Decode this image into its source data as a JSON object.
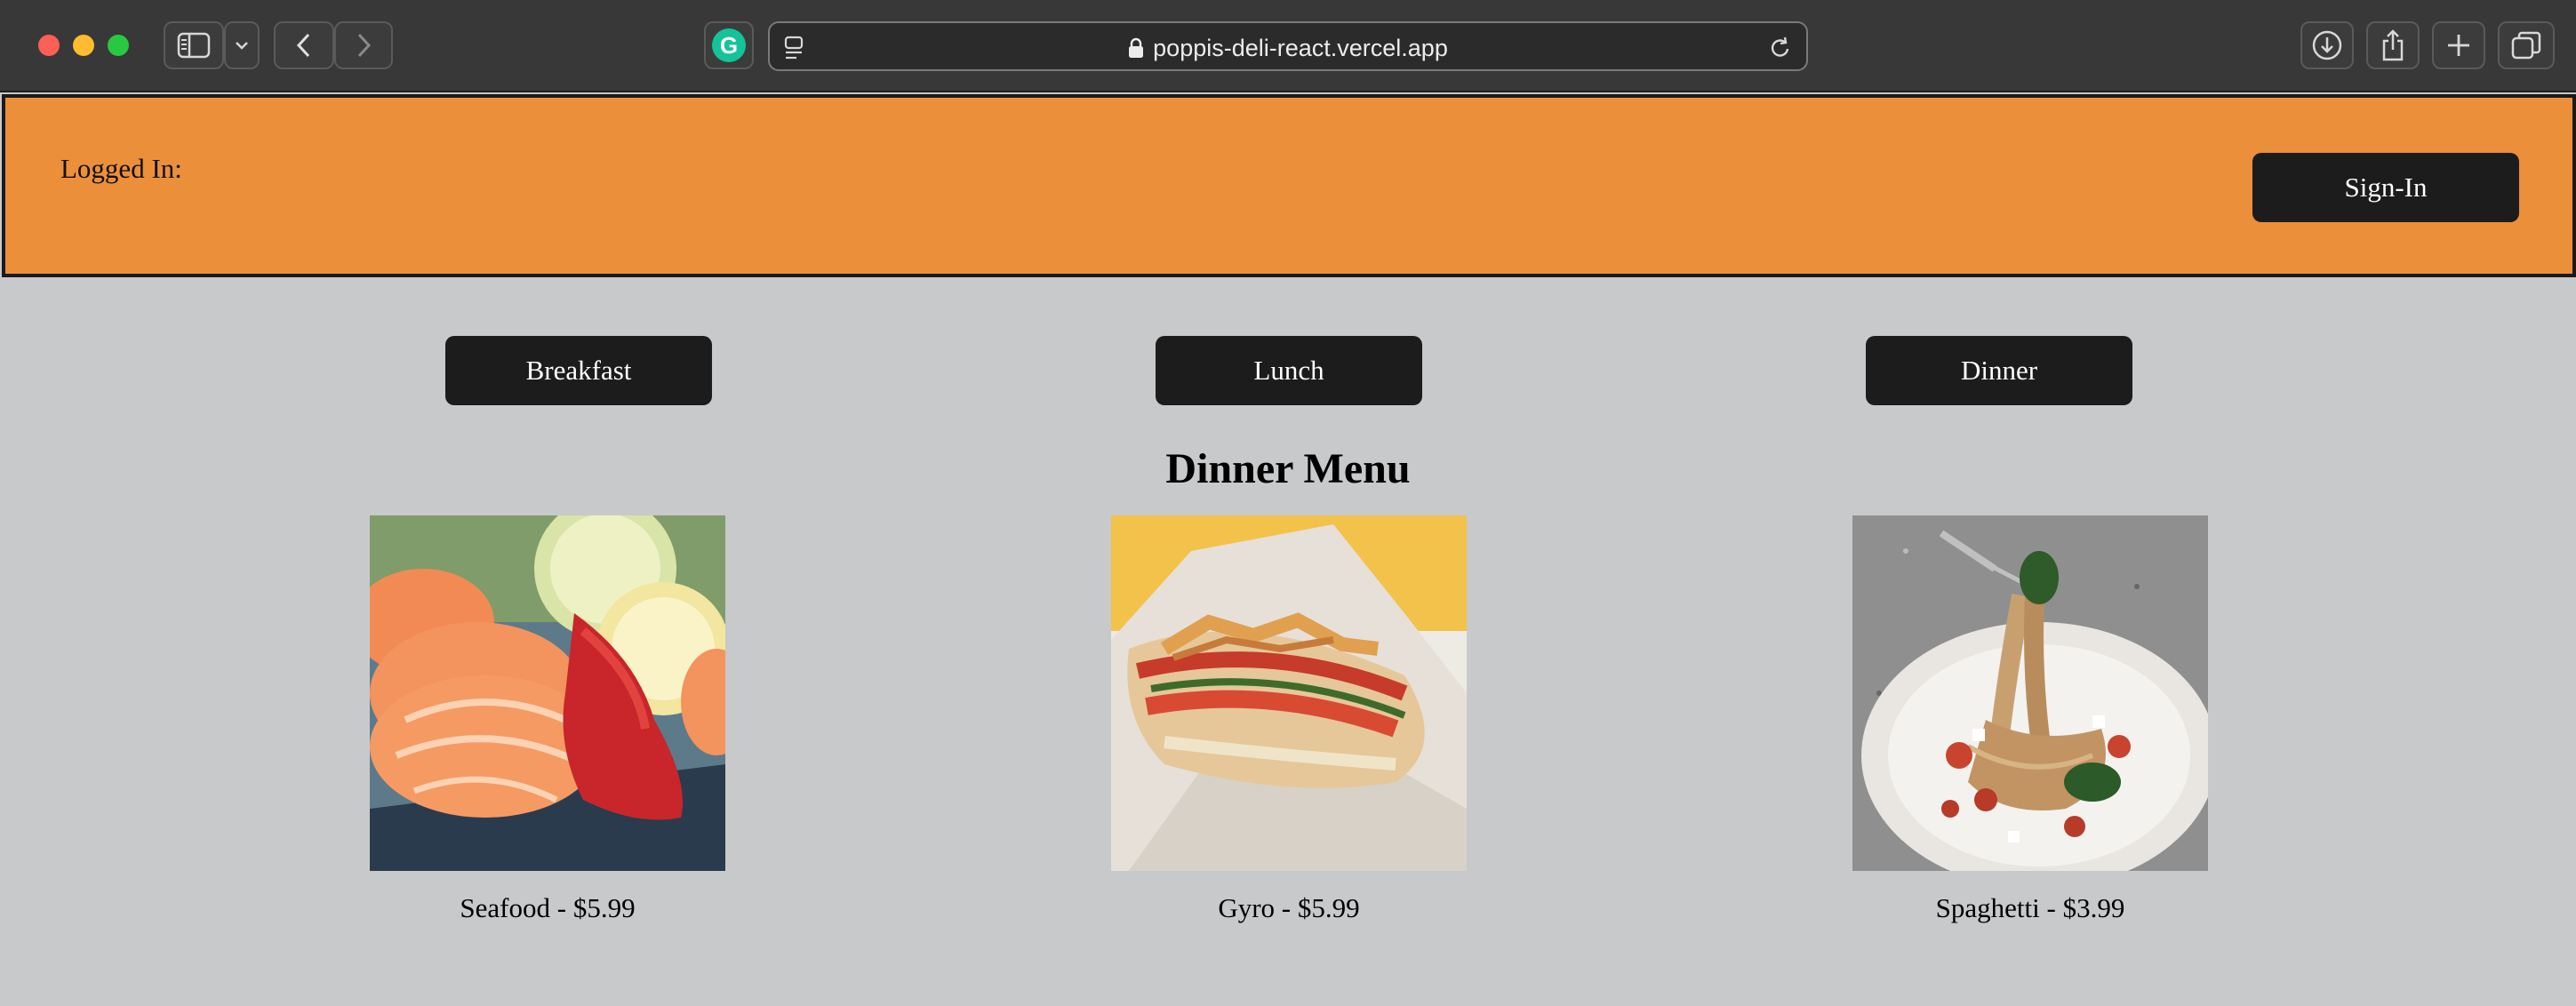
{
  "browser": {
    "url": "poppis-deli-react.vercel.app",
    "extension_icon": "grammarly-icon",
    "extension_letter": "G"
  },
  "header": {
    "logged_in_label": "Logged In:",
    "signin_label": "Sign-In",
    "background_color": "#ec8f3b"
  },
  "tabs": [
    "Breakfast",
    "Lunch",
    "Dinner"
  ],
  "menu": {
    "title": "Dinner Menu",
    "items": [
      {
        "caption": "Seafood - $5.99",
        "image": "salmon-sashimi-photo"
      },
      {
        "caption": "Gyro - $5.99",
        "image": "gyro-wrap-photo"
      },
      {
        "caption": "Spaghetti - $3.99",
        "image": "spaghetti-photo"
      }
    ]
  }
}
